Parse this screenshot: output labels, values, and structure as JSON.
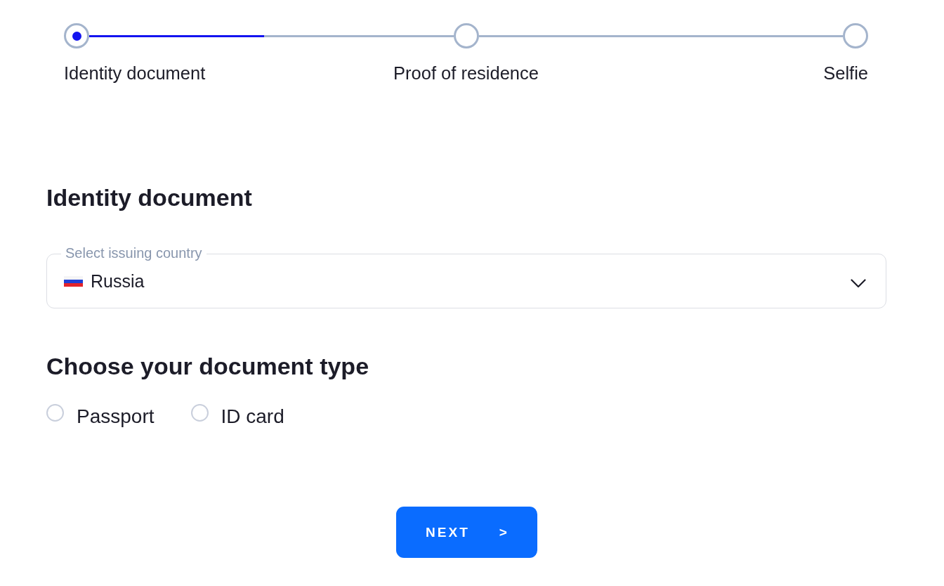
{
  "stepper": {
    "steps": [
      {
        "label": "Identity document",
        "selected": true
      },
      {
        "label": "Proof of residence",
        "selected": false
      },
      {
        "label": "Selfie",
        "selected": false
      }
    ],
    "progress": {
      "level": 0.48
    }
  },
  "section_title": "Identity document",
  "country_select": {
    "label": "Select issuing country",
    "value": "Russia"
  },
  "document_type": {
    "title": "Choose your document type",
    "options": [
      {
        "label": "Passport",
        "selected": false
      },
      {
        "label": "ID card",
        "selected": false
      }
    ]
  },
  "next_button": {
    "label": "NEXT",
    "arrow": ">"
  }
}
